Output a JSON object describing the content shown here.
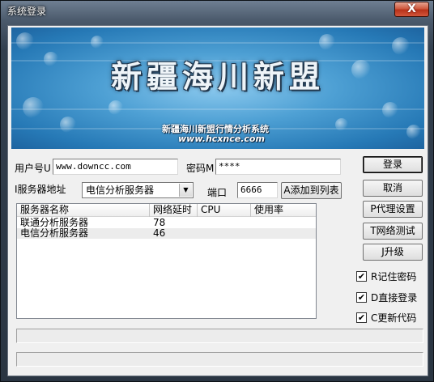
{
  "window": {
    "title": "系统登录",
    "close_glyph": "X"
  },
  "banner": {
    "title": "新疆海川新盟",
    "subtitle": "新疆海川新盟行情分析系统",
    "url": "www.hcxnce.com"
  },
  "form": {
    "username_label": "用户号U",
    "username_value": "www.downcc.com",
    "password_label": "密码M",
    "password_value": "****",
    "server_label": "I服务器地址",
    "server_selected": "电信分析服务器",
    "port_label": "端口",
    "port_value": "6666",
    "add_to_list_label": "A添加到列表"
  },
  "server_list": {
    "columns": [
      "服务器名称",
      "网络延时",
      "CPU",
      "使用率"
    ],
    "rows": [
      {
        "name": "联通分析服务器",
        "latency": "78",
        "cpu": "",
        "usage": ""
      },
      {
        "name": "电信分析服务器",
        "latency": "46",
        "cpu": "",
        "usage": ""
      }
    ]
  },
  "buttons": {
    "login": "登录",
    "cancel": "取消",
    "proxy": "P代理设置",
    "network_test": "T网络测试",
    "upgrade": "J升级"
  },
  "options": {
    "remember_password": {
      "label": "R记住密码",
      "checked": true
    },
    "auto_login": {
      "label": "D直接登录",
      "checked": true
    },
    "update_code": {
      "label": "C更新代码",
      "checked": true
    },
    "check_glyph": "✔"
  },
  "colors": {
    "banner_blue": "#2679b6",
    "titlebar": "#4b5a6c",
    "close_red": "#c8412a"
  }
}
